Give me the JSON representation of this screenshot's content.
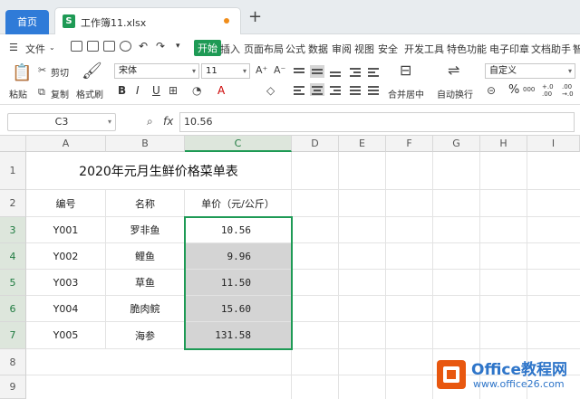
{
  "tabs": {
    "home": "首页",
    "file": "工作簿11.xlsx",
    "new_tab": "+"
  },
  "menu": {
    "file": "文件",
    "items": [
      "开始",
      "插入",
      "页面布局",
      "公式",
      "数据",
      "审阅",
      "视图",
      "安全",
      "开发工具",
      "特色功能",
      "电子印章",
      "文档助手",
      "智"
    ]
  },
  "ribbon": {
    "paste": "粘贴",
    "cut": "剪切",
    "copy": "复制",
    "format_painter": "格式刷",
    "font": "宋体",
    "size": "11",
    "bold": "B",
    "italic": "I",
    "underline": "U",
    "font_color": "A",
    "merge": "合并居中",
    "wrap": "自动换行",
    "number_format": "自定义",
    "percent": "%",
    "thousands": "000",
    "inc_decimal": "+.0 .00",
    "dec_decimal": ".00 →.0"
  },
  "formula_bar": {
    "name_box": "C3",
    "fx": "fx",
    "value": "10.56"
  },
  "columns": [
    "A",
    "B",
    "C",
    "D",
    "E",
    "F",
    "G",
    "H",
    "I"
  ],
  "rows": [
    "1",
    "2",
    "3",
    "4",
    "5",
    "6",
    "7",
    "8",
    "9"
  ],
  "sheet": {
    "title": "2020年元月生鲜价格菜单表",
    "headers": [
      "编号",
      "名称",
      "单价（元/公斤）"
    ],
    "data": [
      [
        "Y001",
        "罗非鱼",
        "10.56"
      ],
      [
        "Y002",
        "鲤鱼",
        "9.96"
      ],
      [
        "Y003",
        "草鱼",
        "11.50"
      ],
      [
        "Y004",
        "脆肉鲩",
        "15.60"
      ],
      [
        "Y005",
        "海参",
        "131.58"
      ]
    ]
  },
  "watermark": {
    "title": "Office教程网",
    "url": "www.office26.com"
  },
  "colors": {
    "accent": "#1e9a55",
    "home_tab": "#2f7bd8",
    "selection_fill": "#d4d4d4"
  }
}
